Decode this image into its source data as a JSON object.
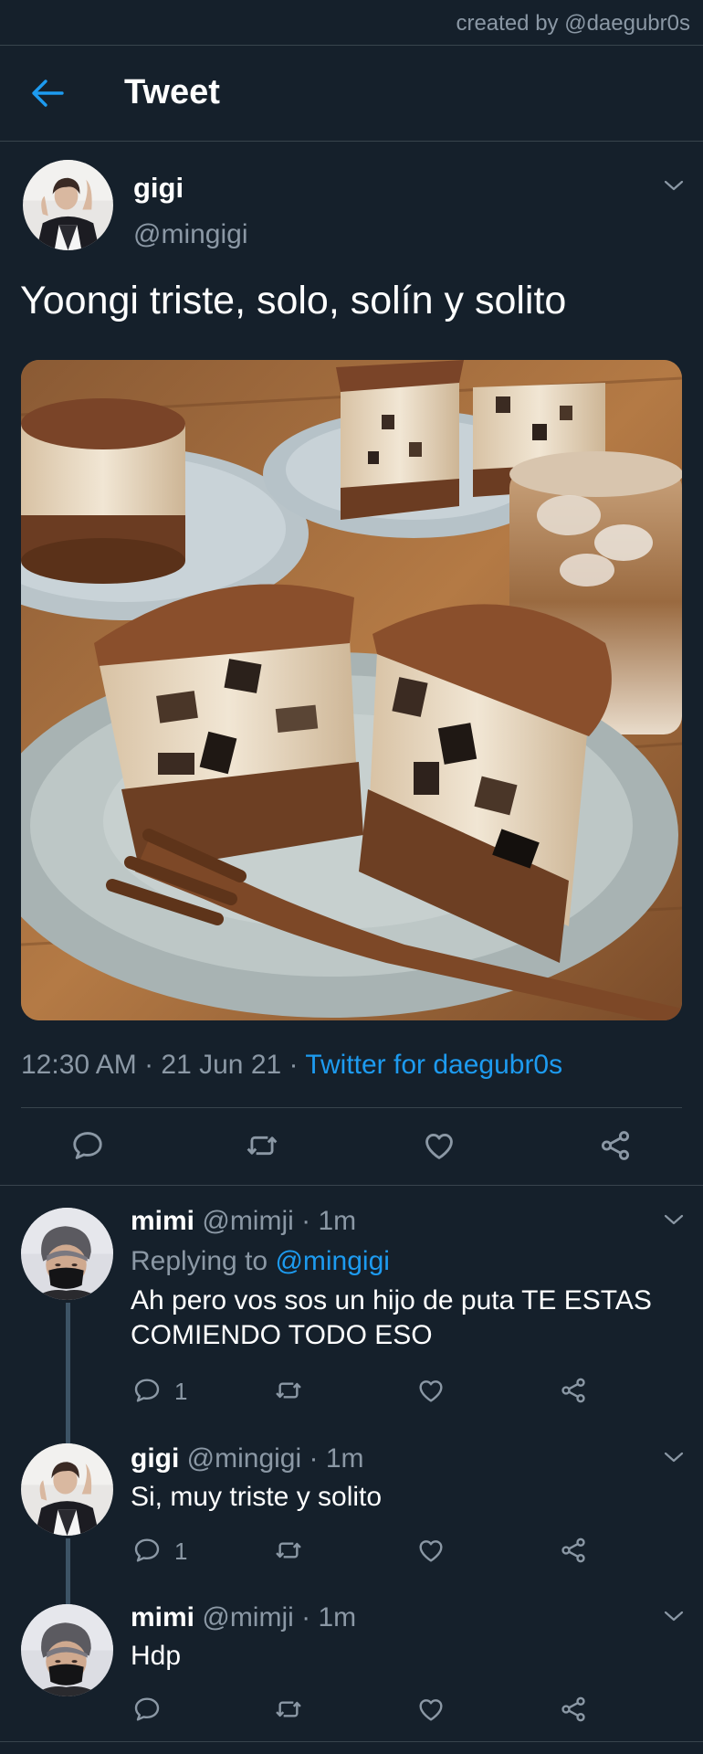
{
  "credit": "created by @daegubr0s",
  "header": {
    "title": "Tweet"
  },
  "tweet": {
    "name": "gigi",
    "handle": "@mingigi",
    "text": "Yoongi triste, solo, solín y solito",
    "time": "12:30 AM · 21 Jun 21 · ",
    "source": "Twitter for daegubr0s"
  },
  "replies": [
    {
      "name": "mimi",
      "meta": " @mimji · 1m",
      "replying_prefix": "Replying to ",
      "replying_handle": "@mingigi",
      "text_line1": "Ah pero vos sos un hijo de puta TE ESTAS",
      "text_line2": "COMIENDO TODO ESO",
      "reply_count": "1"
    },
    {
      "name": "gigi",
      "meta": " @mingigi · 1m",
      "text": "Si, muy triste y solito",
      "reply_count": "1"
    },
    {
      "name": "mimi",
      "meta": " @mimji · 1m",
      "text": "Hdp"
    }
  ],
  "colors": {
    "background": "#15202b",
    "accent": "#1d9bf0",
    "muted": "#8b98a5",
    "divider": "#38444d"
  },
  "icons": {
    "back": "arrow-left-icon",
    "caret": "chevron-down-icon",
    "reply": "speech-bubble-icon",
    "retweet": "retweet-icon",
    "like": "heart-icon",
    "share": "share-icon"
  }
}
